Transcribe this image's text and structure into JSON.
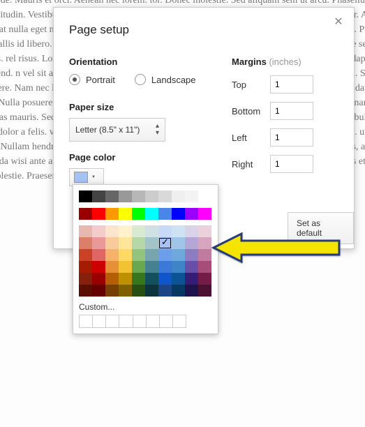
{
  "dialog": {
    "title": "Page setup",
    "orientation": {
      "label": "Orientation",
      "portrait": "Portrait",
      "landscape": "Landscape",
      "selected": "portrait"
    },
    "paper_size": {
      "label": "Paper size",
      "value": "Letter (8.5\" x 11\")"
    },
    "page_color": {
      "label": "Page color",
      "current": "#a4c2f4"
    },
    "margins": {
      "label": "Margins",
      "unit": "(inches)",
      "top_label": "Top",
      "top": "1",
      "bottom_label": "Bottom",
      "bottom": "1",
      "left_label": "Left",
      "left": "1",
      "right_label": "Right",
      "right": "1"
    },
    "set_default": "Set as default"
  },
  "color_picker": {
    "grays": [
      "#000000",
      "#434343",
      "#666666",
      "#999999",
      "#b7b7b7",
      "#cccccc",
      "#d9d9d9",
      "#efefef",
      "#f3f3f3",
      "#ffffff"
    ],
    "brights": [
      "#980000",
      "#ff0000",
      "#ff9900",
      "#ffff00",
      "#00ff00",
      "#00ffff",
      "#4a86e8",
      "#0000ff",
      "#9900ff",
      "#ff00ff"
    ],
    "tints": [
      [
        "#e6b8af",
        "#f4cccc",
        "#fce5cd",
        "#fff2cc",
        "#d9ead3",
        "#d0e0e3",
        "#c9daf8",
        "#cfe2f3",
        "#d9d2e9",
        "#ead1dc"
      ],
      [
        "#dd7e6b",
        "#ea9999",
        "#f9cb9c",
        "#ffe599",
        "#b6d7a8",
        "#a2c4c9",
        "#a4c2f4",
        "#9fc5e8",
        "#b4a7d6",
        "#d5a6bd"
      ],
      [
        "#cc4125",
        "#e06666",
        "#f6b26b",
        "#ffd966",
        "#93c47d",
        "#76a5af",
        "#6d9eeb",
        "#6fa8dc",
        "#8e7cc3",
        "#c27ba0"
      ],
      [
        "#a61c00",
        "#cc0000",
        "#e69138",
        "#f1c232",
        "#6aa84f",
        "#45818e",
        "#3c78d8",
        "#3d85c6",
        "#674ea7",
        "#a64d79"
      ],
      [
        "#85200c",
        "#990000",
        "#b45f06",
        "#bf9000",
        "#38761d",
        "#134f5c",
        "#1155cc",
        "#0b5394",
        "#351c75",
        "#741b47"
      ],
      [
        "#5b0f00",
        "#660000",
        "#783f04",
        "#7f6000",
        "#274e13",
        "#0c343d",
        "#1c4587",
        "#073763",
        "#20124d",
        "#4c1130"
      ]
    ],
    "selected": "#a4c2f4",
    "custom_label": "Custom..."
  },
  "bg_text": "ny pede. Mauris et orci. Aenean nec lorem. tor. Donec molestie. Sed aliquam sem ut arcu. Phasellus sollicitudin. Vestibulum tem condimentum dictum. Nam ac ligula vitae purus bibendum pulvinar. Aenean feugiat nulla eget nisl. Aliquam sagittis ligula vel nisi sagittis est in eros. Morbi a nulla est in mi. Proin convallis id libero. orta tristique laoreet odio sed egestas. ristique diam et orci. as odio est. psque sed purus. rel risus. Lorem eras erat placerat sed mollis. s et netus. ros pellentesque id lacus. metus dapibus eleifend. n vel sit amet. uis wisi vitae. sed posuere luctus purus. eos. Donec nisi. Sed vestibulum. Sed posuere. Nam nec libero. Nulla facilisi. Nulla facilisi. Proin vulputate id erat arcu. Cras dapibus dapibus nisl. Nulla posuere quam id nibh. Cras dapibus dapibus nisl. um volutpat orci et dui. Praesent ornare egestas mauris. Sed cursus quam id felis. posuere quam id quis. Cras dapibus dapibus nisl. Vestibulum quis dolor a felis. vehicula. Maecenas pede purus, tristique ac, tempus eget, egestas quis, mauris. ur non eros. Nullam hendrerit bibendum justo. Fusce iaculis, est quis lacinia pretium. tus molestie lacus, at gravida wisi ante at libero. ornare placerat risus. Ut molestie magna at mi. Integer aliquet mauris et nibh. la molestie. Praesent ut dui sapien in bibendum."
}
